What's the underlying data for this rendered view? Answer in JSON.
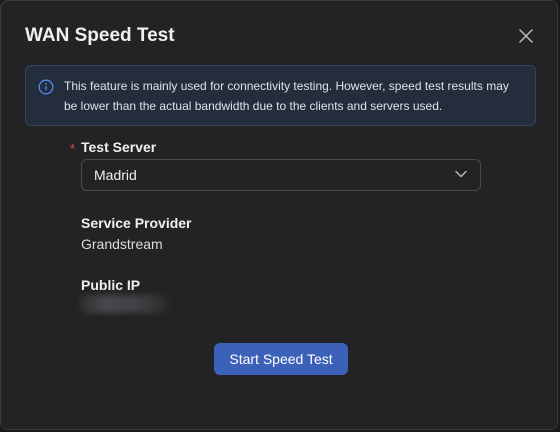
{
  "dialog": {
    "title": "WAN Speed Test",
    "notice": "This feature is mainly used for connectivity testing. However, speed test results may be lower than the actual bandwidth due to the clients and servers used."
  },
  "form": {
    "test_server": {
      "label": "Test Server",
      "required_mark": "*",
      "selected": "Madrid"
    },
    "service_provider": {
      "label": "Service Provider",
      "value": "Grandstream"
    },
    "public_ip": {
      "label": "Public IP"
    }
  },
  "actions": {
    "start_label": "Start Speed Test"
  },
  "colors": {
    "background": "#232325",
    "accent": "#3b62b8",
    "info": "#4f8ef7",
    "required": "#e5484d"
  },
  "icons": {
    "close": "close-icon",
    "info": "info-icon",
    "dropdown": "chevron-down-icon"
  }
}
